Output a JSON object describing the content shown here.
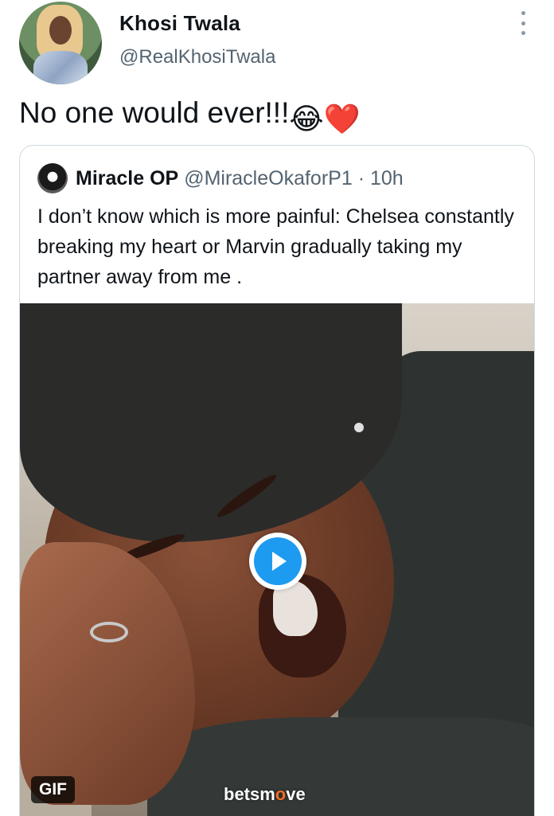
{
  "tweet": {
    "author_name": "Khosi Twala",
    "author_handle": "@RealKhosiTwala",
    "text": "No one would ever!!!",
    "emojis": [
      "😂",
      "❤️"
    ],
    "more_icon": "more-vertical-icon"
  },
  "quoted_tweet": {
    "author_name": "Miracle OP",
    "author_handle": "@MiracleOkaforP1",
    "time_separator": " · ",
    "time": "10h",
    "text": "I don’t know which is more painful: Chelsea constantly breaking my heart or Marvin gradually taking my partner away from me .",
    "media": {
      "badge": "GIF",
      "watermark_main": "betsm",
      "watermark_accent": "o",
      "watermark_end": "ve",
      "play_icon": "play-icon",
      "accent_color": "#1d9bf0"
    }
  }
}
